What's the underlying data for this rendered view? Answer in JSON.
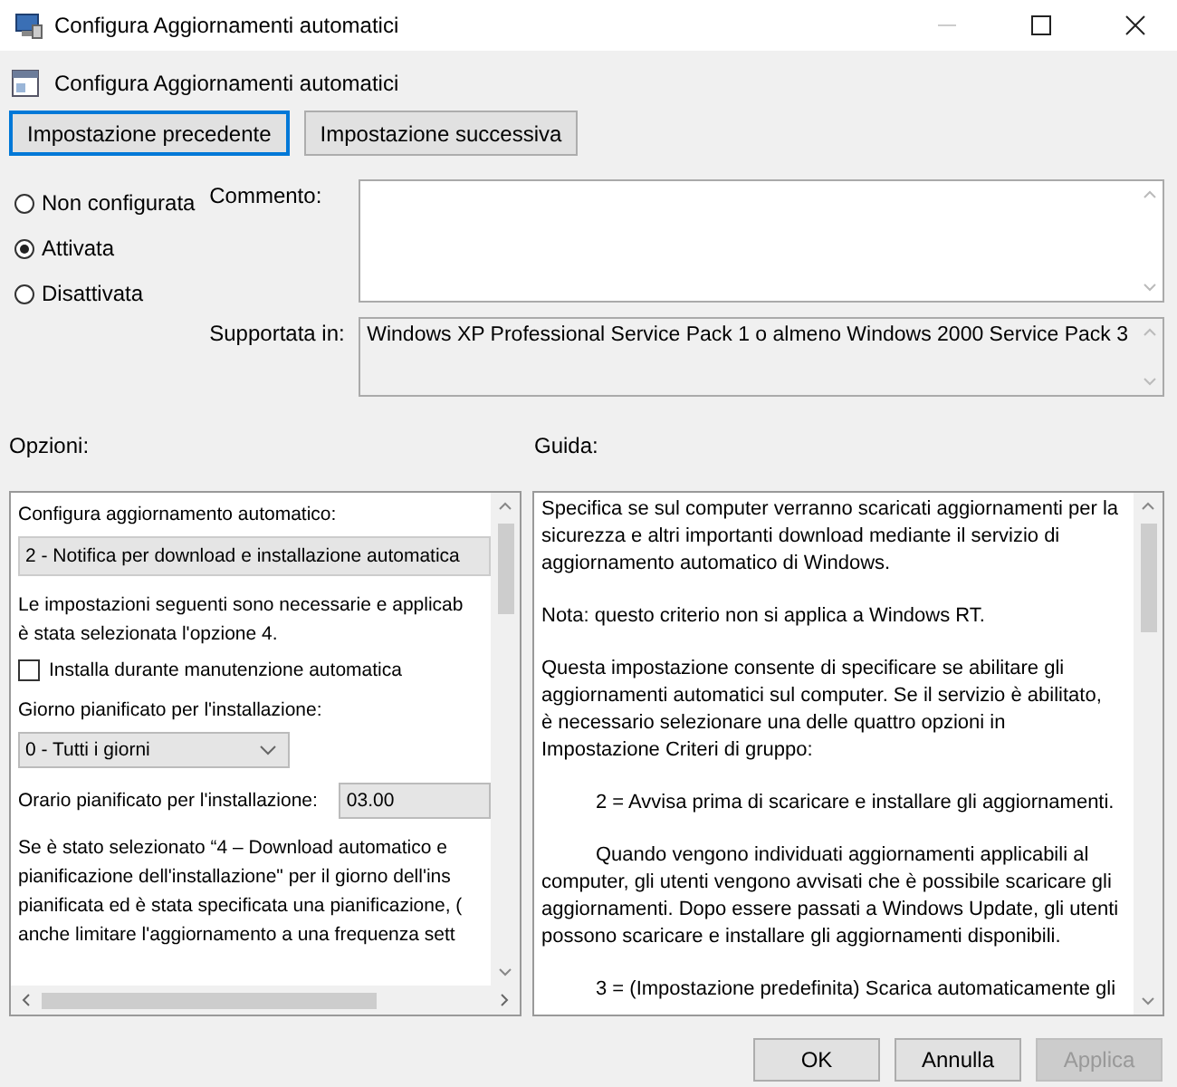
{
  "window": {
    "title": "Configura Aggiornamenti automatici"
  },
  "header": {
    "title": "Configura Aggiornamenti automatici"
  },
  "nav_buttons": [
    {
      "label": "Impostazione precedente",
      "focused": true
    },
    {
      "label": "Impostazione successiva",
      "focused": false
    }
  ],
  "radio_options": [
    {
      "label": "Non configurata",
      "selected": false
    },
    {
      "label": "Attivata",
      "selected": true
    },
    {
      "label": "Disattivata",
      "selected": false
    }
  ],
  "comment": {
    "label": "Commento:"
  },
  "supported_on": {
    "label": "Supportata in:",
    "value": "Windows XP Professional Service Pack 1 o almeno Windows 2000 Service Pack 3"
  },
  "options_label": "Opzioni:",
  "help_label": "Guida:",
  "options": [
    {
      "kind": "label",
      "text": "Configura aggiornamento automatico:"
    },
    {
      "kind": "wide-select",
      "value": "2 - Notifica per download e installazione automatica"
    },
    {
      "kind": "text",
      "lines": [
        "Le impostazioni seguenti sono necessarie e applicab",
        "è stata selezionata l'opzione 4."
      ]
    },
    {
      "kind": "checkbox",
      "text": "Installa durante manutenzione automatica",
      "checked": false
    },
    {
      "kind": "label",
      "text": "Giorno pianificato per l'installazione:"
    },
    {
      "kind": "select",
      "value": "0 - Tutti i giorni"
    },
    {
      "kind": "time",
      "text": "Orario pianificato per l'installazione:",
      "value": "03.00"
    },
    {
      "kind": "text",
      "lines": [
        "Se è stato selezionato “4 – Download automatico e",
        "pianificazione dell'installazione\" per il giorno dell'ins",
        "pianificata ed è stata specificata una pianificazione, (",
        "anche limitare l'aggiornamento a una frequenza sett"
      ]
    }
  ],
  "help_paragraphs": [
    {
      "lines": [
        "Specifica se sul computer verranno scaricati aggiornamenti per la",
        "sicurezza e altri importanti download mediante il servizio di",
        "aggiornamento automatico di Windows."
      ],
      "indented": false
    },
    {
      "lines": [
        "Nota: questo criterio non si applica a Windows RT."
      ],
      "indented": false
    },
    {
      "lines": [
        "Questa impostazione consente di specificare se abilitare gli",
        "aggiornamenti automatici sul computer. Se il servizio è abilitato,",
        "è necessario selezionare una delle quattro opzioni in",
        "Impostazione Criteri di gruppo:"
      ],
      "indented": false
    },
    {
      "lines": [
        "2 = Avvisa prima di scaricare e installare gli aggiornamenti."
      ],
      "indented": true
    },
    {
      "lines": [
        "Quando vengono individuati aggiornamenti applicabili al",
        "computer, gli utenti vengono avvisati che è possibile scaricare gli",
        "aggiornamenti. Dopo essere passati a Windows Update, gli utenti",
        "possono scaricare e installare gli aggiornamenti disponibili."
      ],
      "indented": true
    },
    {
      "lines": [
        "3 = (Impostazione predefinita) Scarica automaticamente gli"
      ],
      "indented": true
    }
  ],
  "buttons": [
    {
      "label": "OK",
      "disabled": false
    },
    {
      "label": "Annulla",
      "disabled": false
    },
    {
      "label": "Applica",
      "disabled": true
    }
  ]
}
